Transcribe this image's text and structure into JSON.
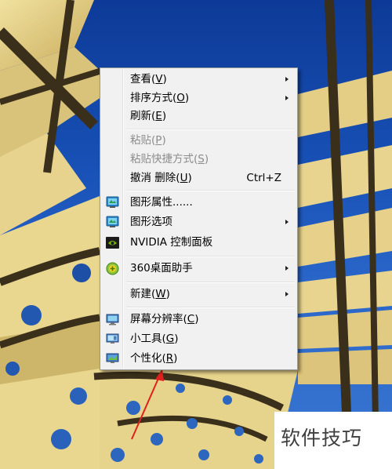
{
  "menu": {
    "items": [
      {
        "text": "查看(",
        "key": "V",
        "end": ")",
        "submenu": true
      },
      {
        "text": "排序方式(",
        "key": "O",
        "end": ")",
        "submenu": true
      },
      {
        "text": "刷新(",
        "key": "E",
        "end": ")"
      },
      {
        "text": "粘贴(",
        "key": "P",
        "end": ")",
        "disabled": true
      },
      {
        "text": "粘贴快捷方式(",
        "key": "S",
        "end": ")",
        "disabled": true
      },
      {
        "text": "撤消 删除(",
        "key": "U",
        "end": ")",
        "shortcut": "Ctrl+Z"
      },
      {
        "text": "图形属性......",
        "icon": "intel-graphics-icon"
      },
      {
        "text": "图形选项",
        "icon": "intel-graphics-icon",
        "submenu": true
      },
      {
        "text": "NVIDIA 控制面板",
        "icon": "nvidia-icon"
      },
      {
        "text": "360桌面助手",
        "icon": "360-icon",
        "submenu": true
      },
      {
        "text": "新建(",
        "key": "W",
        "end": ")",
        "submenu": true
      },
      {
        "text": "屏幕分辨率(",
        "key": "C",
        "end": ")",
        "icon": "monitor-icon"
      },
      {
        "text": "小工具(",
        "key": "G",
        "end": ")",
        "icon": "gadgets-icon"
      },
      {
        "text": "个性化(",
        "key": "R",
        "end": ")",
        "icon": "personalize-icon"
      }
    ]
  },
  "watermark": {
    "text": "软件技巧"
  },
  "colors": {
    "sky": "#1850b5",
    "menu_bg": "#f1f1f1",
    "disabled_text": "#8c8c8c",
    "arrow_red": "#e0201c"
  }
}
